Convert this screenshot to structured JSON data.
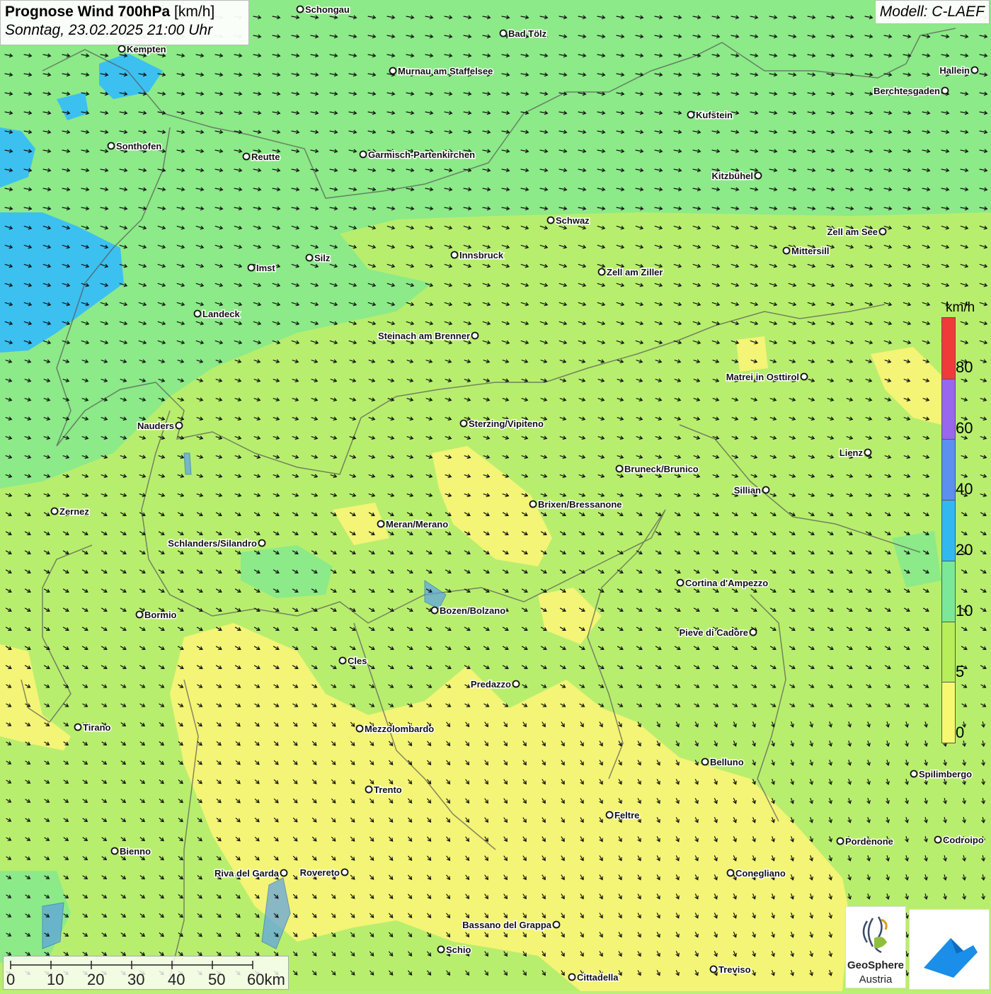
{
  "header": {
    "title_bold": "Prognose Wind 700hPa",
    "title_unit": "[km/h]",
    "datetime": "Sonntag, 23.02.2025 21:00 Uhr",
    "model": "Modell: C-LAEF"
  },
  "legend": {
    "unit": "km/h",
    "ticks": [
      "80",
      "60",
      "40",
      "20",
      "10",
      "5",
      "0"
    ],
    "bands": [
      {
        "range": "80+",
        "color": "#f03a3a"
      },
      {
        "range": "60-80",
        "color": "#9966ee"
      },
      {
        "range": "40-60",
        "color": "#5b8ff0"
      },
      {
        "range": "20-40",
        "color": "#32b8f0"
      },
      {
        "range": "10-20",
        "color": "#7ae898"
      },
      {
        "range": "5-10",
        "color": "#b8ee5a"
      },
      {
        "range": "0-5",
        "color": "#f8f870"
      }
    ]
  },
  "scalebar": {
    "labels": [
      "0",
      "10",
      "20",
      "30",
      "40",
      "50",
      "60km"
    ]
  },
  "logos": {
    "geosphere_line1": "GeoSphere",
    "geosphere_line2": "Austria"
  },
  "cities": [
    {
      "name": "Schongau"
    },
    {
      "name": "Bad Tölz"
    },
    {
      "name": "Kempten"
    },
    {
      "name": "Murnau am Staffelsee"
    },
    {
      "name": "Hallein"
    },
    {
      "name": "Berchtesgaden"
    },
    {
      "name": "Kufstein"
    },
    {
      "name": "Sonthofen"
    },
    {
      "name": "Reutte"
    },
    {
      "name": "Garmisch-Partenkirchen"
    },
    {
      "name": "Kitzbühel"
    },
    {
      "name": "Schwaz"
    },
    {
      "name": "Zell am See"
    },
    {
      "name": "Mittersill"
    },
    {
      "name": "Innsbruck"
    },
    {
      "name": "Silz"
    },
    {
      "name": "Imst"
    },
    {
      "name": "Zell am Ziller"
    },
    {
      "name": "Landeck"
    },
    {
      "name": "Steinach am Brenner"
    },
    {
      "name": "Matrei in Osttirol"
    },
    {
      "name": "Nauders"
    },
    {
      "name": "Sterzing/Vipiteno"
    },
    {
      "name": "Lienz"
    },
    {
      "name": "Bruneck/Brunico"
    },
    {
      "name": "Sillian"
    },
    {
      "name": "Brixen/Bressanone"
    },
    {
      "name": "Zernez"
    },
    {
      "name": "Meran/Merano"
    },
    {
      "name": "Schlanders/Silandro"
    },
    {
      "name": "Cortina d'Ampezzo"
    },
    {
      "name": "Bozen/Bolzano"
    },
    {
      "name": "Bormio"
    },
    {
      "name": "Pieve di Cadore"
    },
    {
      "name": "Cles"
    },
    {
      "name": "Predazzo"
    },
    {
      "name": "Tirano"
    },
    {
      "name": "Mezzolombardo"
    },
    {
      "name": "Belluno"
    },
    {
      "name": "Spilimbergo"
    },
    {
      "name": "Trento"
    },
    {
      "name": "Feltre"
    },
    {
      "name": "Pordenone"
    },
    {
      "name": "Codroipo"
    },
    {
      "name": "Bienno"
    },
    {
      "name": "Riva del Garda"
    },
    {
      "name": "Rovereto"
    },
    {
      "name": "Conegliano"
    },
    {
      "name": "Bassano del Grappa"
    },
    {
      "name": "Schio"
    },
    {
      "name": "Treviso"
    },
    {
      "name": "Cittadella"
    }
  ]
}
